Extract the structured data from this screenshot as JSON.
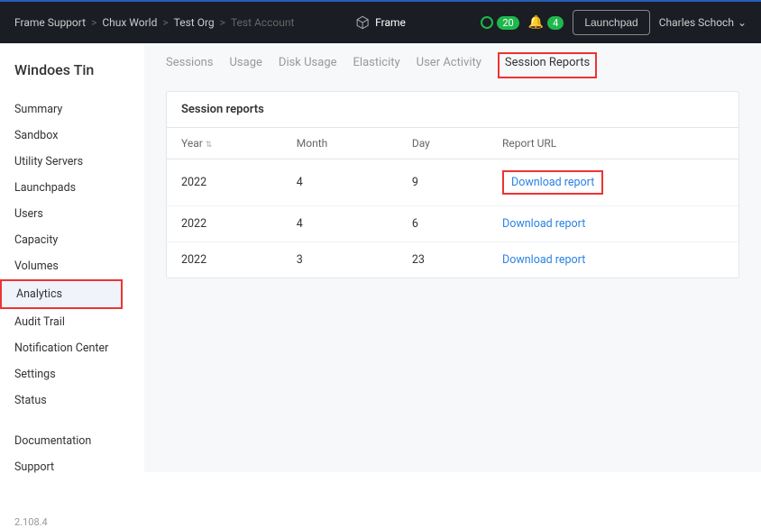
{
  "breadcrumb": {
    "items": [
      "Frame Support",
      "Chux World",
      "Test Org",
      "Test Account"
    ]
  },
  "brand": "Frame",
  "header": {
    "status_count": "20",
    "notif_count": "4",
    "launchpad_btn": "Launchpad",
    "user": "Charles Schoch"
  },
  "sidebar": {
    "title": "Windoes Tin",
    "items": [
      "Summary",
      "Sandbox",
      "Utility Servers",
      "Launchpads",
      "Users",
      "Capacity",
      "Volumes",
      "Analytics",
      "Audit Trail",
      "Notification Center",
      "Settings",
      "Status"
    ],
    "bottom": [
      "Documentation",
      "Support"
    ],
    "version": "2.108.4"
  },
  "tabs": [
    "Sessions",
    "Usage",
    "Disk Usage",
    "Elasticity",
    "User Activity",
    "Session Reports"
  ],
  "panel": {
    "title": "Session reports",
    "columns": [
      "Year",
      "Month",
      "Day",
      "Report URL"
    ],
    "rows": [
      {
        "year": "2022",
        "month": "4",
        "day": "9",
        "url": "Download report"
      },
      {
        "year": "2022",
        "month": "4",
        "day": "6",
        "url": "Download report"
      },
      {
        "year": "2022",
        "month": "3",
        "day": "23",
        "url": "Download report"
      }
    ]
  }
}
